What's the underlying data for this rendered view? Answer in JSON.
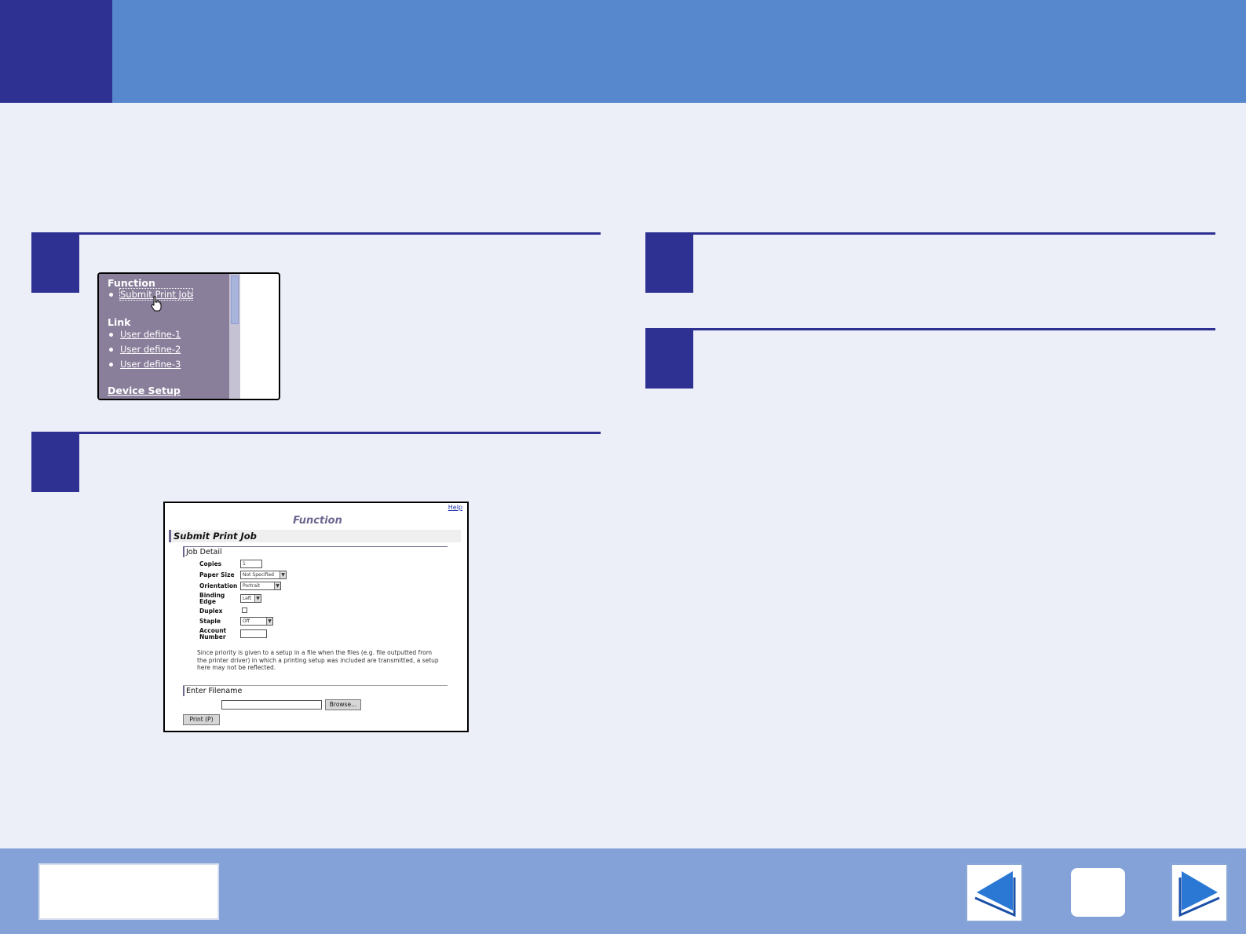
{
  "menu_screenshot": {
    "function_heading": "Function",
    "function_items": [
      "Submit Print Job"
    ],
    "link_heading": "Link",
    "link_items": [
      "User define-1",
      "User define-2",
      "User define-3"
    ],
    "device_setup": "Device Setup"
  },
  "submit_screenshot": {
    "help_link": "Help",
    "title": "Function",
    "page_heading": "Submit Print Job",
    "job_detail_heading": "Job Detail",
    "fields": {
      "copies_label": "Copies",
      "copies_value": "1",
      "paper_size_label": "Paper Size",
      "paper_size_value": "Not Specified",
      "orientation_label": "Orientation",
      "orientation_value": "Portrait",
      "binding_edge_label_1": "Binding",
      "binding_edge_label_2": "Edge",
      "binding_edge_value": "Left",
      "duplex_label": "Duplex",
      "staple_label": "Staple",
      "staple_value": "Off",
      "account_number_label_1": "Account",
      "account_number_label_2": "Number"
    },
    "note": "Since priority is given to a setup in a file when the files (e.g. file outputted from the printer driver) in which a printing setup was included are transmitted, a setup here may not be reflected.",
    "enter_filename_heading": "Enter Filename",
    "browse_button": "Browse...",
    "print_button": "Print (P)"
  },
  "icons": {
    "back": "triangle-left-icon",
    "home": "home-icon",
    "forward": "triangle-right-icon",
    "cursor": "hand-pointer-icon"
  },
  "colors": {
    "header": "#5787cc",
    "accent": "#2e3192",
    "background": "#eceff8",
    "footer": "#85a2d8",
    "nav_arrow": "#2b78d4"
  }
}
